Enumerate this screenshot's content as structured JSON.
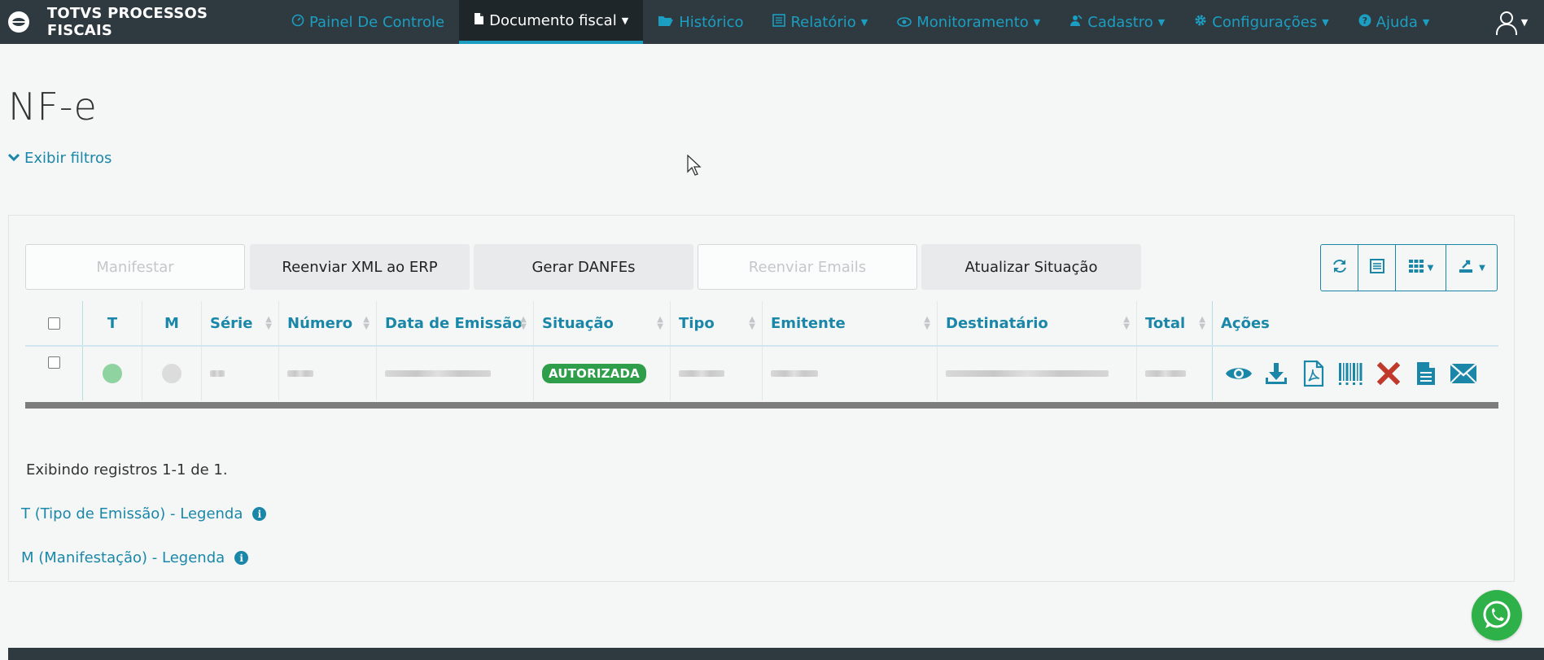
{
  "app": {
    "brand": "TOTVS PROCESSOS FISCAIS"
  },
  "nav": {
    "items": [
      {
        "label": "Painel De Controle",
        "icon": "dashboard-icon",
        "caret": false,
        "active": false
      },
      {
        "label": "Documento fiscal",
        "icon": "document-icon",
        "caret": true,
        "active": true
      },
      {
        "label": "Histórico",
        "icon": "folder-open-icon",
        "caret": false,
        "active": false
      },
      {
        "label": "Relatório",
        "icon": "list-icon",
        "caret": true,
        "active": false
      },
      {
        "label": "Monitoramento",
        "icon": "eye-icon",
        "caret": true,
        "active": false
      },
      {
        "label": "Cadastro",
        "icon": "user-edit-icon",
        "caret": true,
        "active": false
      },
      {
        "label": "Configurações",
        "icon": "gear-icon",
        "caret": true,
        "active": false
      },
      {
        "label": "Ajuda",
        "icon": "question-circle-icon",
        "caret": true,
        "active": false
      }
    ],
    "user_icon": "user-icon"
  },
  "page": {
    "title": "NF-e",
    "filters_toggle": "Exibir filtros"
  },
  "toolbar": {
    "manifestar": "Manifestar",
    "reenviar_xml": "Reenviar XML ao ERP",
    "gerar_danfes": "Gerar DANFEs",
    "reenviar_emails": "Reenviar Emails",
    "atualizar_situacao": "Atualizar Situação",
    "icon_buttons": [
      "refresh-icon",
      "list-view-icon",
      "columns-grid-icon",
      "export-icon"
    ]
  },
  "table": {
    "headers": {
      "t": "T",
      "m": "M",
      "serie": "Série",
      "numero": "Número",
      "data_emissao": "Data de Emissão",
      "situacao": "Situação",
      "tipo": "Tipo",
      "emitente": "Emitente",
      "destinatario": "Destinatário",
      "total": "Total",
      "acoes": "Ações"
    },
    "rows": [
      {
        "tipo_emissao_color": "#8fd3a0",
        "manifestacao_color": "#dcdcdc",
        "situacao": "AUTORIZADA",
        "situacao_color": "#2e9e4a"
      }
    ],
    "row_actions": [
      "view-icon",
      "download-icon",
      "pdf-icon",
      "barcode-icon",
      "cancel-icon",
      "document-text-icon",
      "email-icon"
    ]
  },
  "footer_info": {
    "records": "Exibindo registros 1-1 de 1.",
    "legend_t": "T (Tipo de Emissão) - Legenda",
    "legend_m": "M (Manifestação) - Legenda"
  },
  "colors": {
    "navbar": "#2e3a40",
    "accent": "#1b9ec1",
    "link": "#1b87a8",
    "success": "#2e9e4a",
    "danger": "#c0392b",
    "whatsapp": "#2fb14a"
  }
}
